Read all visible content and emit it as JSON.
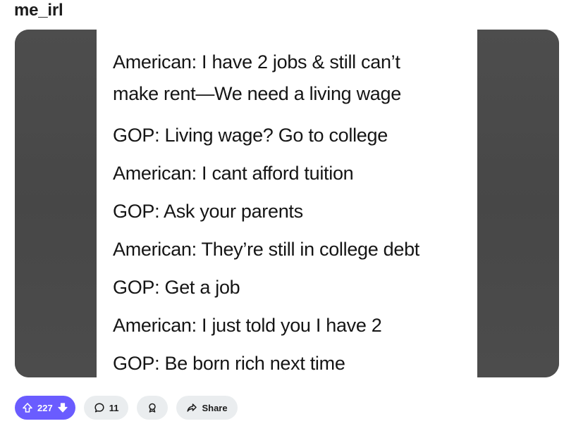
{
  "post": {
    "subreddit": "me_irl"
  },
  "meme": {
    "lines": [
      "American: I have 2 jobs & still can’t",
      "make rent—We need a living wage",
      "GOP: Living wage? Go to college",
      "American: I cant afford tuition",
      "GOP: Ask your parents",
      "American: They’re still in college debt",
      "GOP: Get a job",
      "American: I just told you I have 2",
      "GOP: Be born rich next time"
    ]
  },
  "actions": {
    "vote_count": "227",
    "comment_count": "11",
    "share_label": "Share",
    "colors": {
      "vote_bg": "#6a5cff",
      "pill_bg": "#eaedef"
    },
    "icons": [
      "upvote-icon",
      "downvote-icon",
      "comment-icon",
      "award-icon",
      "share-icon"
    ]
  }
}
